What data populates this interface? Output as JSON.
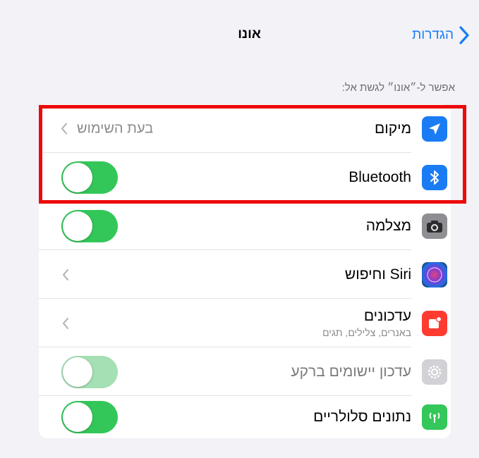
{
  "nav": {
    "title": "אונו",
    "back_label": "הגדרות"
  },
  "section_header": "אפשר ל-״אונו״ לגשת אל:",
  "rows": [
    {
      "label": "מיקום",
      "value": "בעת השימוש",
      "icon": "location-arrow-icon",
      "icon_color": "#1a7cf5",
      "control": "chevron"
    },
    {
      "label": "Bluetooth",
      "icon": "bluetooth-icon",
      "icon_color": "#1a7cf5",
      "control": "toggle",
      "on": true
    },
    {
      "label": "מצלמה",
      "icon": "camera-icon",
      "icon_color": "#8e8e93",
      "control": "toggle",
      "on": true
    },
    {
      "label": "Siri וחיפוש",
      "icon": "siri-icon",
      "control": "chevron"
    },
    {
      "label": "עדכונים",
      "sublabel": "באנרים, צלילים, תגים",
      "icon": "notification-bell-icon",
      "icon_color": "#ff3b30",
      "control": "chevron"
    },
    {
      "label": "עדכון יישומים ברקע",
      "icon": "gear-icon",
      "icon_color": "#c7c7cc",
      "control": "toggle",
      "on": true,
      "disabled": true
    },
    {
      "label": "נתונים סלולריים",
      "icon": "cellular-antenna-icon",
      "icon_color": "#34c759",
      "control": "toggle",
      "on": true
    }
  ],
  "colors": {
    "accent": "#1a7cf5",
    "toggle_on": "#33c759",
    "highlight": "#ec0b0b",
    "background": "#f2f2f7"
  }
}
